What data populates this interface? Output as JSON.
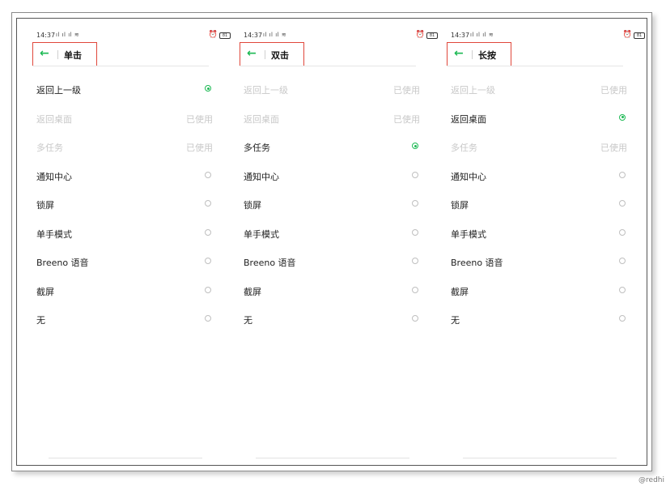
{
  "status_bar": {
    "time": "14:37",
    "signal": "ıl ıl ıl ≋",
    "alarm_icon": "alarm-icon",
    "battery": "81"
  },
  "panels": [
    {
      "title": "单击",
      "items": [
        {
          "label": "返回上一级",
          "state": "",
          "selected": true,
          "disabled": false
        },
        {
          "label": "返回桌面",
          "state": "已使用",
          "selected": false,
          "disabled": true
        },
        {
          "label": "多任务",
          "state": "已使用",
          "selected": false,
          "disabled": true
        },
        {
          "label": "通知中心",
          "state": "",
          "selected": false,
          "disabled": false
        },
        {
          "label": "锁屏",
          "state": "",
          "selected": false,
          "disabled": false
        },
        {
          "label": "单手模式",
          "state": "",
          "selected": false,
          "disabled": false
        },
        {
          "label": "Breeno 语音",
          "state": "",
          "selected": false,
          "disabled": false
        },
        {
          "label": "截屏",
          "state": "",
          "selected": false,
          "disabled": false
        },
        {
          "label": "无",
          "state": "",
          "selected": false,
          "disabled": false
        }
      ]
    },
    {
      "title": "双击",
      "items": [
        {
          "label": "返回上一级",
          "state": "已使用",
          "selected": false,
          "disabled": true
        },
        {
          "label": "返回桌面",
          "state": "已使用",
          "selected": false,
          "disabled": true
        },
        {
          "label": "多任务",
          "state": "",
          "selected": true,
          "disabled": false
        },
        {
          "label": "通知中心",
          "state": "",
          "selected": false,
          "disabled": false
        },
        {
          "label": "锁屏",
          "state": "",
          "selected": false,
          "disabled": false
        },
        {
          "label": "单手模式",
          "state": "",
          "selected": false,
          "disabled": false
        },
        {
          "label": "Breeno 语音",
          "state": "",
          "selected": false,
          "disabled": false
        },
        {
          "label": "截屏",
          "state": "",
          "selected": false,
          "disabled": false
        },
        {
          "label": "无",
          "state": "",
          "selected": false,
          "disabled": false
        }
      ]
    },
    {
      "title": "长按",
      "items": [
        {
          "label": "返回上一级",
          "state": "已使用",
          "selected": false,
          "disabled": true
        },
        {
          "label": "返回桌面",
          "state": "",
          "selected": true,
          "disabled": false
        },
        {
          "label": "多任务",
          "state": "已使用",
          "selected": false,
          "disabled": true
        },
        {
          "label": "通知中心",
          "state": "",
          "selected": false,
          "disabled": false
        },
        {
          "label": "锁屏",
          "state": "",
          "selected": false,
          "disabled": false
        },
        {
          "label": "单手模式",
          "state": "",
          "selected": false,
          "disabled": false
        },
        {
          "label": "Breeno 语音",
          "state": "",
          "selected": false,
          "disabled": false
        },
        {
          "label": "截屏",
          "state": "",
          "selected": false,
          "disabled": false
        },
        {
          "label": "无",
          "state": "",
          "selected": false,
          "disabled": false
        }
      ]
    }
  ],
  "icons": {
    "back": "back-arrow-icon",
    "radio": "radio-icon"
  },
  "colors": {
    "accent": "#1db954",
    "highlight_box": "#e0473b",
    "disabled_text": "#c8c8c8"
  },
  "watermark": "@redhi"
}
